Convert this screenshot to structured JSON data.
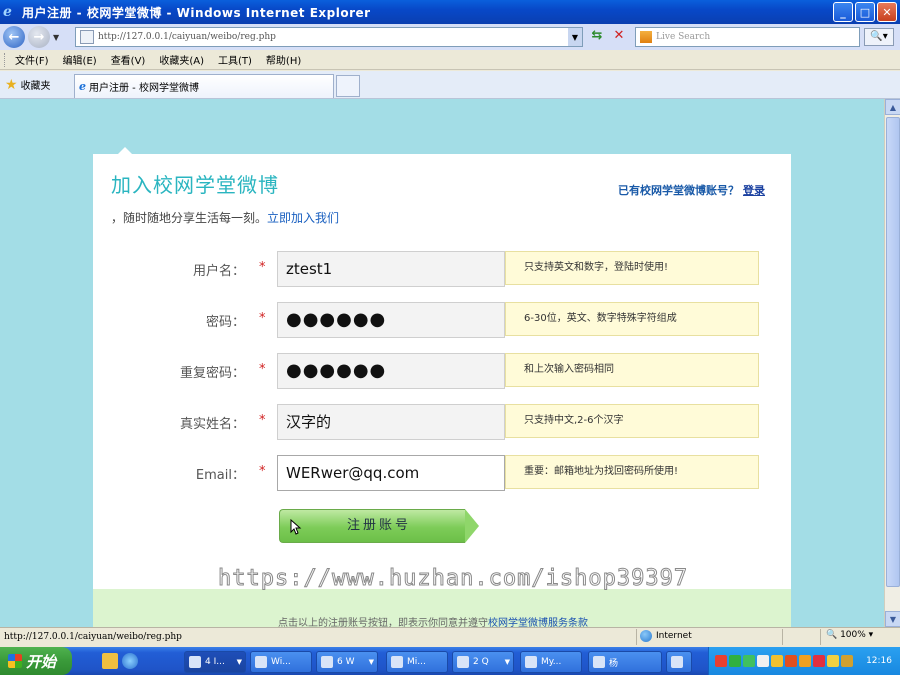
{
  "window": {
    "title": "用户注册 - 校网学堂微博 - Windows Internet Explorer",
    "minimize": "_",
    "maximize": "□",
    "close": "✕"
  },
  "browser": {
    "url": "http://127.0.0.1/caiyuan/weibo/reg.php",
    "search_placeholder": "Live Search",
    "menu": [
      "文件(F)",
      "编辑(E)",
      "查看(V)",
      "收藏夹(A)",
      "工具(T)",
      "帮助(H)"
    ],
    "favorites_label": "收藏夹",
    "tab_title": "用户注册 - 校网学堂微博"
  },
  "page": {
    "title": "加入校网学堂微博",
    "subtitle_prefix": "，随时随地分享生活每一刻。",
    "subtitle_link": "立即加入我们",
    "has_account_text": "已有校网学堂微博账号？",
    "login_link": "登录",
    "form": [
      {
        "label": "用户名：",
        "required": "*",
        "value": "ztest1",
        "type": "text",
        "hint": "只支持英文和数字，登陆时使用!"
      },
      {
        "label": "密码：",
        "required": "*",
        "value": "●●●●●●",
        "type": "password",
        "hint": "6-30位，英文、数字特殊字符组成"
      },
      {
        "label": "重复密码：",
        "required": "*",
        "value": "●●●●●●",
        "type": "password",
        "hint": "和上次输入密码相同"
      },
      {
        "label": "真实姓名：",
        "required": "*",
        "value": "汉字的",
        "type": "text",
        "hint": "只支持中文,2-6个汉字"
      },
      {
        "label": "Email：",
        "required": "*",
        "value": "WERwer@qq.com",
        "type": "text",
        "hint": "重要：邮箱地址为找回密码所使用!"
      }
    ],
    "submit_label": "注册账号",
    "footer_text": "点击以上的注册账号按钮，即表示你同意并遵守",
    "footer_link": "校网学堂微博服务条款",
    "watermark": "https://www.huzhan.com/ishop39397"
  },
  "statusbar": {
    "url": "http://127.0.0.1/caiyuan/weibo/reg.php",
    "zone": "Internet",
    "zoom": "100%"
  },
  "taskbar": {
    "start_label": "开始",
    "tasks": [
      "4 I...",
      "Wi...",
      "6 W",
      "Mi...",
      "2 Q",
      "My...",
      "杨"
    ],
    "clock": "12:16"
  },
  "colors": {
    "page_bg": "#a3dde6",
    "title_color": "#2ab5c0",
    "hint_bg": "#fffbd8",
    "submit_green": "#7dcc58"
  }
}
